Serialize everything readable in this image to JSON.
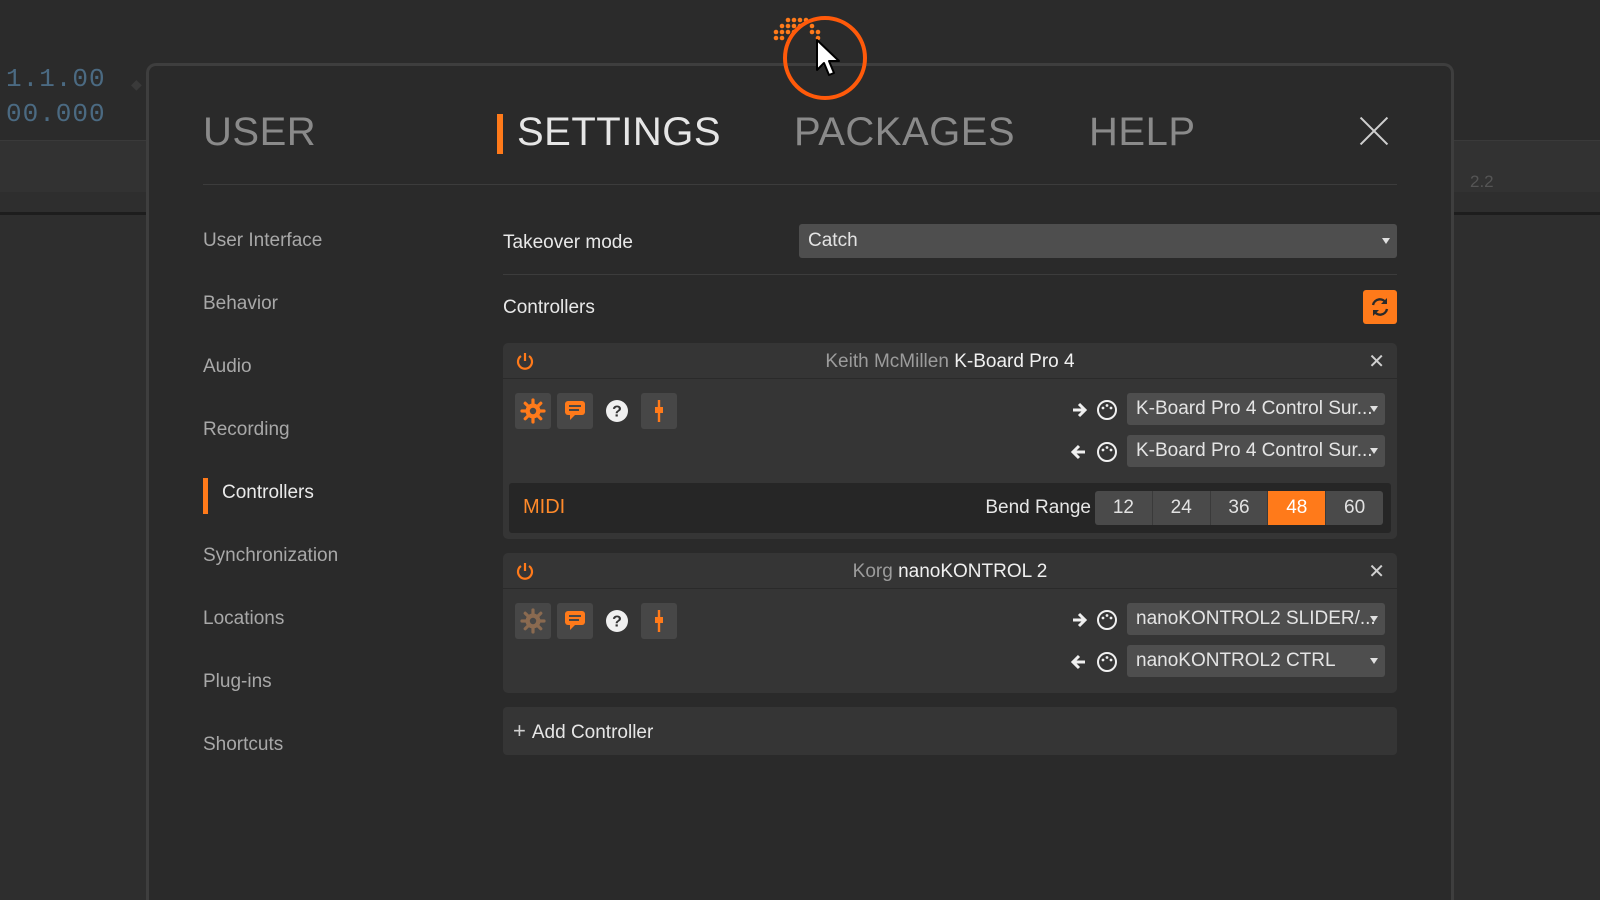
{
  "background": {
    "time_top": "1.1.00",
    "time_bottom": "00.000",
    "ruler_label": "2.2"
  },
  "tabs": [
    {
      "label": "USER",
      "active": false
    },
    {
      "label": "SETTINGS",
      "active": true
    },
    {
      "label": "PACKAGES",
      "active": false
    },
    {
      "label": "HELP",
      "active": false
    }
  ],
  "sidebar": {
    "items": [
      {
        "label": "User Interface"
      },
      {
        "label": "Behavior"
      },
      {
        "label": "Audio"
      },
      {
        "label": "Recording"
      },
      {
        "label": "Controllers",
        "active": true
      },
      {
        "label": "Synchronization"
      },
      {
        "label": "Locations"
      },
      {
        "label": "Plug-ins"
      },
      {
        "label": "Shortcuts"
      }
    ]
  },
  "settings": {
    "takeover_label": "Takeover mode",
    "takeover_value": "Catch",
    "controllers_label": "Controllers"
  },
  "controllers": [
    {
      "vendor": "Keith McMillen",
      "model": "K-Board Pro 4",
      "input_port": "K-Board Pro 4 Control Sur...",
      "output_port": "K-Board Pro 4 Control Sur...",
      "midi_label": "MIDI",
      "bend_range_label": "Bend Range",
      "bend_options": [
        "12",
        "24",
        "36",
        "48",
        "60"
      ],
      "bend_selected": "48"
    },
    {
      "vendor": "Korg",
      "model": "nanoKONTROL 2",
      "input_port": "nanoKONTROL2 SLIDER/...",
      "output_port": "nanoKONTROL2 CTRL"
    }
  ],
  "add_controller_label": "Add Controller",
  "colors": {
    "accent": "#ff7a1a",
    "panel": "#2a2a2a",
    "card": "#353535"
  },
  "icons": [
    "close-icon",
    "refresh-icon",
    "power-icon",
    "gear-icon",
    "chat-icon",
    "help-icon",
    "pin-icon",
    "arrow-right-icon",
    "arrow-left-icon",
    "midi-port-icon",
    "plus-icon",
    "mouse-pointer-icon"
  ]
}
